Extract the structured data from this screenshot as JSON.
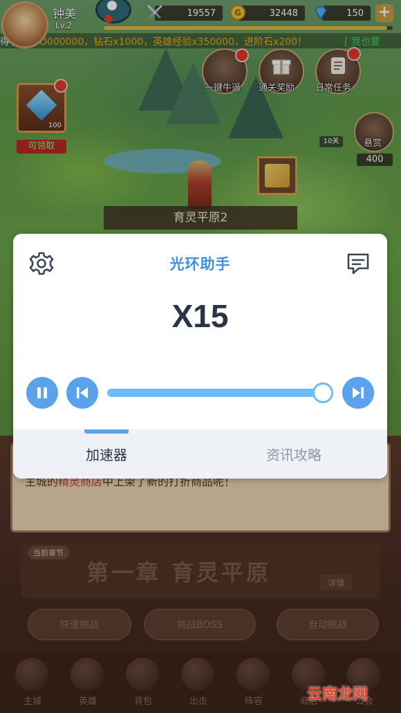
{
  "game": {
    "player": {
      "name": "钟美",
      "level": "Lv.2"
    },
    "resources": [
      {
        "name": "power",
        "icon": "crossed-swords-icon",
        "value": "19557"
      },
      {
        "name": "gold",
        "icon": "gold-coin-icon",
        "value": "32448"
      },
      {
        "name": "diamond",
        "icon": "diamond-icon",
        "value": "150"
      }
    ],
    "xp_fraction": 0.98,
    "marquee": {
      "prefix": "得了",
      "reward_text": "VVO000000，钻石x1000，英雄经验x350000，进阶石x200！",
      "cta": "[ 我也要"
    },
    "features": {
      "one_click": "一键牛逼",
      "clear_reward": "通关奖励",
      "daily_tasks": "日常任务",
      "gem_count": "100",
      "claim": "可领取",
      "bounty": "悬赏",
      "bounty_count": "400",
      "stage_tag": "10关"
    },
    "region": "育灵平原2",
    "notice": {
      "pre": "主城的",
      "highlight": "精灵商店",
      "post": "中上架了新的打折商品呢！"
    },
    "chapter": {
      "tag": "当前章节",
      "title": "第一章  育灵平原",
      "button": "详情"
    },
    "actions": [
      "快速挑战",
      "挑战BOSS",
      "自动挑战"
    ],
    "nav": [
      "主城",
      "英雄",
      "背包",
      "出击",
      "阵容",
      "商店",
      "公会"
    ]
  },
  "assistant": {
    "title": "光环助手",
    "speed": "X15",
    "speed_fraction": 1.0,
    "icons": {
      "settings": "gear-icon",
      "feedback": "chat-bubble-icon",
      "pause": "pause-icon",
      "previous": "skip-back-icon",
      "next": "skip-forward-icon"
    },
    "accent": "#5aa2ec",
    "tabs": [
      {
        "label": "加速器",
        "active": true
      },
      {
        "label": "资讯攻略",
        "active": false
      }
    ]
  },
  "watermark": "云南龙网"
}
